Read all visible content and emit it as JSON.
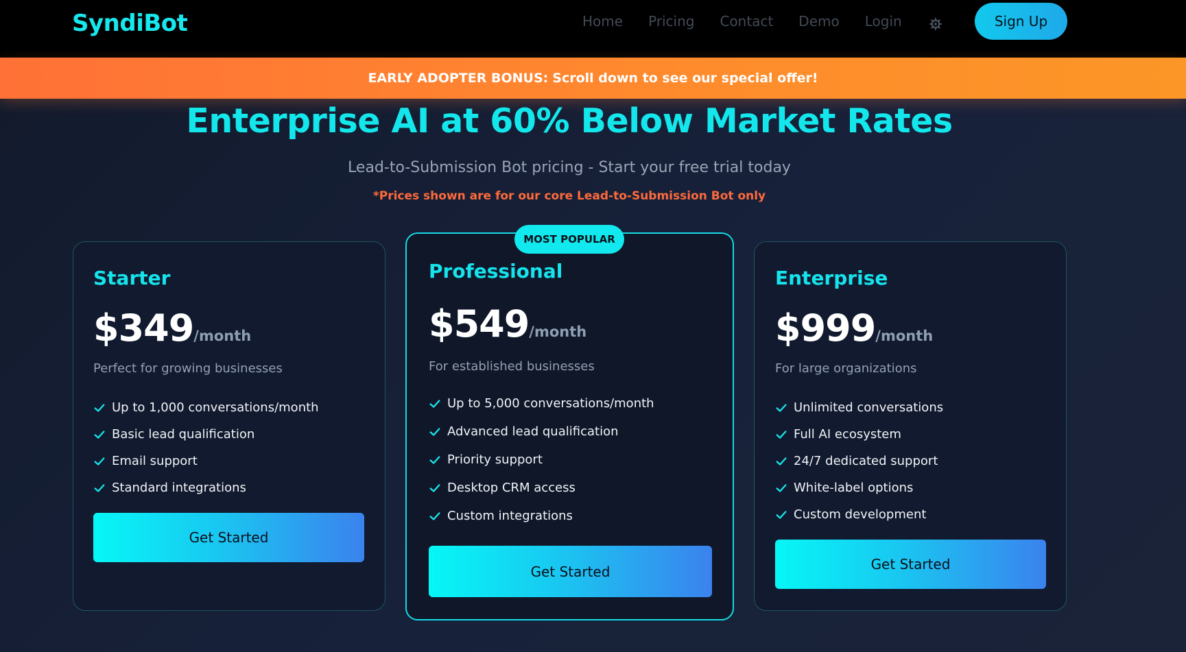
{
  "nav": {
    "logo": "SyndiBot",
    "links": [
      "Home",
      "Pricing",
      "Contact",
      "Demo",
      "Login"
    ],
    "theme_icon": "gear-icon",
    "signup_label": "Sign Up"
  },
  "banner": {
    "lead": "EARLY ADOPTER BONUS:",
    "text": "Scroll down to see our special offer!"
  },
  "hero": {
    "title": "Enterprise AI at 60% Below Market Rates",
    "subtitle": "Lead-to-Submission Bot pricing - Start your free trial today",
    "note": "*Prices shown are for our core Lead-to-Submission Bot only"
  },
  "plans": [
    {
      "name": "Starter",
      "price": "$349",
      "period": "/month",
      "description": "Perfect for growing businesses",
      "features": [
        "Up to 1,000 conversations/month",
        "Basic lead qualification",
        "Email support",
        "Standard integrations"
      ],
      "cta": "Get Started"
    },
    {
      "name": "Professional",
      "badge": "MOST POPULAR",
      "price": "$549",
      "period": "/month",
      "description": "For established businesses",
      "features": [
        "Up to 5,000 conversations/month",
        "Advanced lead qualification",
        "Priority support",
        "Desktop CRM access",
        "Custom integrations"
      ],
      "cta": "Get Started"
    },
    {
      "name": "Enterprise",
      "price": "$999",
      "period": "/month",
      "description": "For large organizations",
      "features": [
        "Unlimited conversations",
        "Full AI ecosystem",
        "24/7 dedicated support",
        "White-label options",
        "Custom development"
      ],
      "cta": "Get Started"
    }
  ],
  "colors": {
    "accent": "#14e7ec",
    "banner": "#ff7a33",
    "note": "#ff6a3c"
  }
}
